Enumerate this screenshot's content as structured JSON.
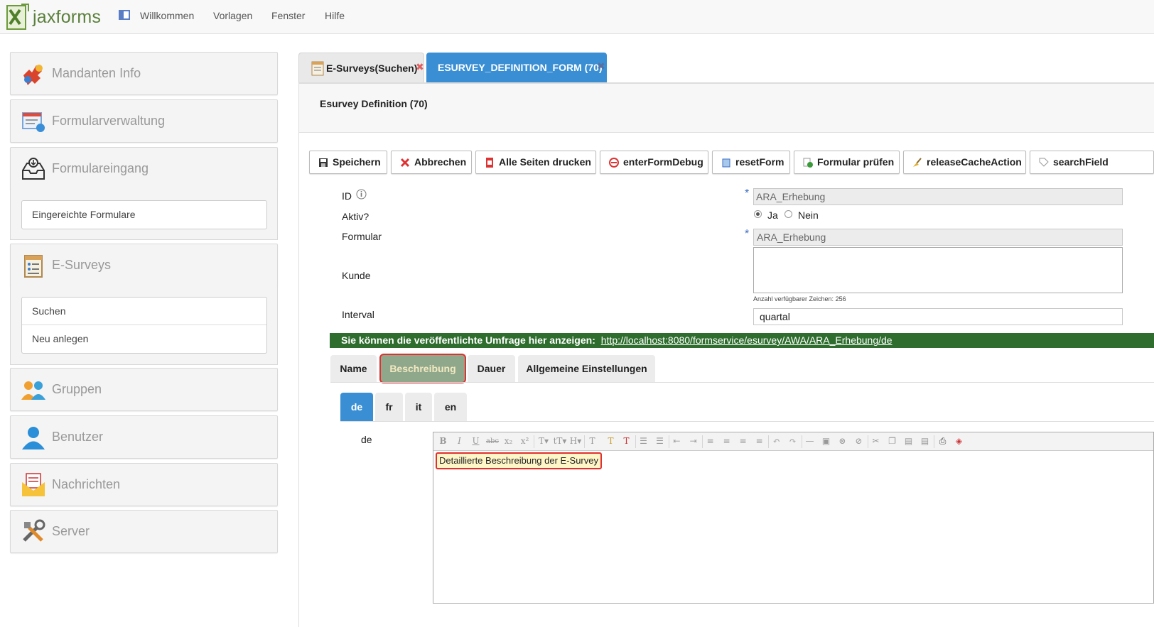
{
  "app": {
    "logo_text": "jaxforms",
    "menu": [
      "Willkommen",
      "Vorlagen",
      "Fenster",
      "Hilfe"
    ]
  },
  "sidebar": {
    "sections": [
      {
        "label": "Mandanten Info",
        "icon": "puzzle-icon"
      },
      {
        "label": "Formularverwaltung",
        "icon": "form-admin-icon"
      },
      {
        "label": "Formulareingang",
        "icon": "inbox-icon",
        "items": [
          "Eingereichte Formulare"
        ]
      },
      {
        "label": "E-Surveys",
        "icon": "survey-icon",
        "items": [
          "Suchen",
          "Neu anlegen"
        ]
      },
      {
        "label": "Gruppen",
        "icon": "group-icon"
      },
      {
        "label": "Benutzer",
        "icon": "user-icon"
      },
      {
        "label": "Nachrichten",
        "icon": "mail-icon"
      },
      {
        "label": "Server",
        "icon": "tools-icon"
      }
    ]
  },
  "tabs": [
    {
      "label": "E-Surveys(Suchen)",
      "active": false
    },
    {
      "label": "ESURVEY_DEFINITION_FORM (70)",
      "active": true
    }
  ],
  "form": {
    "title": "Esurvey Definition (70)",
    "toolbar": [
      "Speichern",
      "Abbrechen",
      "Alle Seiten drucken",
      "enterFormDebug",
      "resetForm",
      "Formular prüfen",
      "releaseCacheAction",
      "searchField"
    ],
    "fields": {
      "id": {
        "label": "ID",
        "value": "ARA_Erhebung",
        "required": "*"
      },
      "aktiv": {
        "label": "Aktiv?",
        "options": [
          "Ja",
          "Nein"
        ],
        "selected": "Ja"
      },
      "formular": {
        "label": "Formular",
        "value": "ARA_Erhebung",
        "required": "*"
      },
      "kunde": {
        "label": "Kunde",
        "value": "",
        "counter": "Anzahl verfügbarer Zeichen: 256"
      },
      "interval": {
        "label": "Interval",
        "value": "quartal"
      }
    },
    "link_notice": {
      "text": "Sie können die veröffentlichte Umfrage hier anzeigen:",
      "url": "http://localhost:8080/formservice/esurvey/AWA/ARA_Erhebung/de"
    },
    "subtabs": [
      "Name",
      "Beschreibung",
      "Dauer",
      "Allgemeine Einstellungen"
    ],
    "active_subtab": "Beschreibung",
    "lang_tabs": [
      "de",
      "fr",
      "it",
      "en"
    ],
    "active_lang": "de",
    "editor": {
      "label": "de",
      "content": "Detaillierte Beschreibung der E-Survey"
    }
  },
  "colors": {
    "tab_active": "#3a8fd4",
    "green_bar": "#2e6d2e",
    "subtab_active": "#8fa88c",
    "highlight_border": "#e03030",
    "editor_highlight": "#fff6c8"
  }
}
